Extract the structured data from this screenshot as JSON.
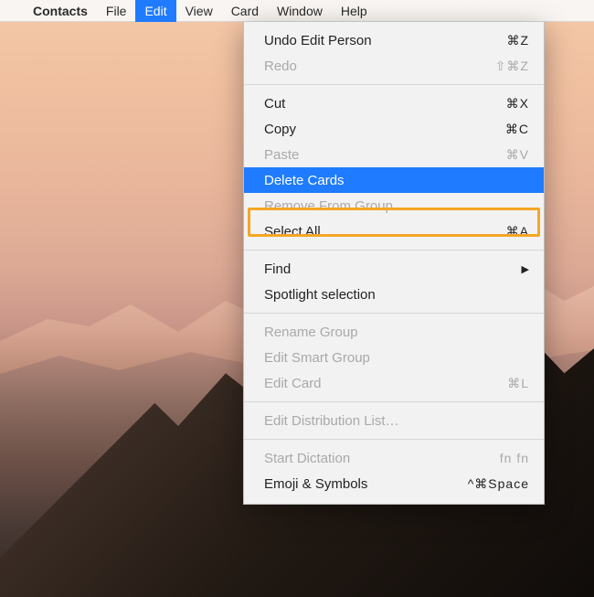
{
  "menubar": {
    "app_name": "Contacts",
    "items": [
      {
        "label": "File"
      },
      {
        "label": "Edit",
        "active": true
      },
      {
        "label": "View"
      },
      {
        "label": "Card"
      },
      {
        "label": "Window"
      },
      {
        "label": "Help"
      }
    ]
  },
  "edit_menu": {
    "groups": [
      [
        {
          "label": "Undo Edit Person",
          "shortcut": "⌘Z",
          "enabled": true
        },
        {
          "label": "Redo",
          "shortcut": "⇧⌘Z",
          "enabled": false
        }
      ],
      [
        {
          "label": "Cut",
          "shortcut": "⌘X",
          "enabled": true
        },
        {
          "label": "Copy",
          "shortcut": "⌘C",
          "enabled": true
        },
        {
          "label": "Paste",
          "shortcut": "⌘V",
          "enabled": false
        },
        {
          "label": "Delete Cards",
          "shortcut": "",
          "enabled": true,
          "selected": true,
          "highlighted": true
        },
        {
          "label": "Remove From Group",
          "shortcut": "",
          "enabled": false
        },
        {
          "label": "Select All",
          "shortcut": "⌘A",
          "enabled": true
        }
      ],
      [
        {
          "label": "Find",
          "submenu": true,
          "enabled": true
        },
        {
          "label": "Spotlight selection",
          "shortcut": "",
          "enabled": true
        }
      ],
      [
        {
          "label": "Rename Group",
          "shortcut": "",
          "enabled": false
        },
        {
          "label": "Edit Smart Group",
          "shortcut": "",
          "enabled": false
        },
        {
          "label": "Edit Card",
          "shortcut": "⌘L",
          "enabled": false
        }
      ],
      [
        {
          "label": "Edit Distribution List…",
          "shortcut": "",
          "enabled": false
        }
      ],
      [
        {
          "label": "Start Dictation",
          "shortcut": "fn fn",
          "enabled": false
        },
        {
          "label": "Emoji & Symbols",
          "shortcut": "^⌘Space",
          "enabled": true
        }
      ]
    ]
  },
  "colors": {
    "menu_highlight": "#1f7bff",
    "annotation_border": "#f5a623"
  }
}
